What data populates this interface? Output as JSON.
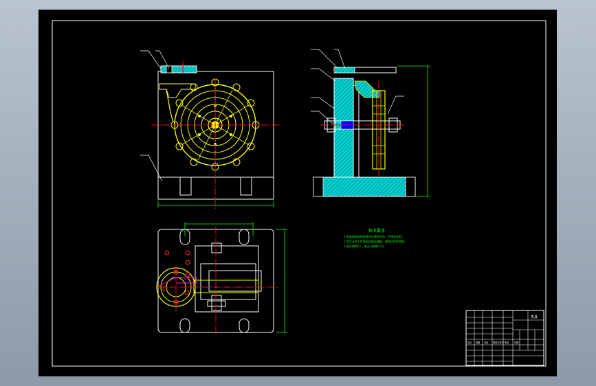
{
  "drawing": {
    "background_color": "#000000",
    "frame_color": "#ffffff",
    "centerline_color": "#ff0000",
    "part_color": "#ffff00",
    "hatch_color": "#00e5e5",
    "dimension_color": "#00ff00",
    "notes_color": "#00ff00",
    "views": [
      "front-view",
      "side-view",
      "top-view"
    ],
    "notes": {
      "heading": "技术要求",
      "lines": [
        "1.夹具装配前所有零件应清洗干净，不得有毛刺；",
        "2.定位元件工作表面应保证精度，装配后检验合格；",
        "3.未注倒角C1，未注公差按IT12。"
      ]
    },
    "title_block": {
      "label_row": [
        "标记",
        "处数",
        "分区",
        "更改文件号",
        "签名",
        "日期"
      ],
      "name": "夹具"
    }
  }
}
